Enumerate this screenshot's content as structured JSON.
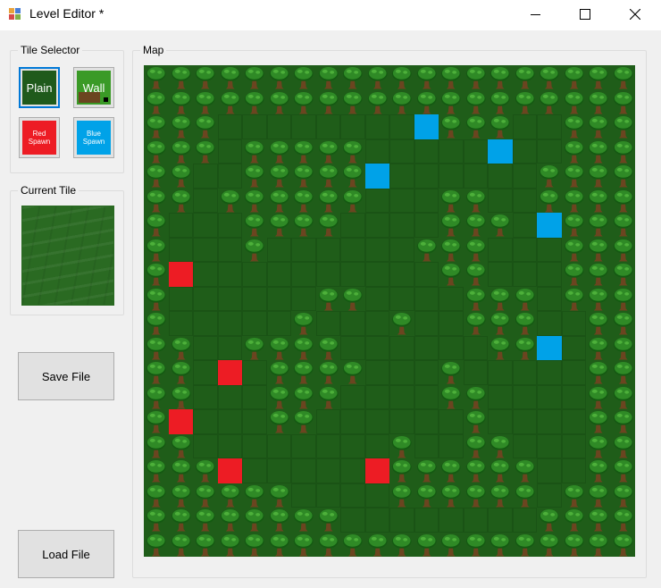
{
  "window": {
    "title": "Level Editor *"
  },
  "tile_selector": {
    "label": "Tile Selector",
    "tiles": [
      {
        "label": "Plain",
        "selected": true
      },
      {
        "label": "Wall",
        "selected": false
      },
      {
        "label": "Red Spawn",
        "selected": false
      },
      {
        "label": "Blue Spawn",
        "selected": false
      }
    ]
  },
  "current_tile": {
    "label": "Current Tile",
    "tile": "plain"
  },
  "buttons": {
    "save": "Save File",
    "load": "Load File"
  },
  "map": {
    "label": "Map",
    "columns": 20,
    "rows": 20,
    "legend": {
      "P": "plain",
      "W": "wall (tree)",
      "R": "red spawn",
      "B": "blue spawn"
    },
    "grid": [
      "WWWWWWWWWWWWWWWWWWWW",
      "WWWWWWWWWWWWWWWWWWWW",
      "WWWPPPPPPPPBWWWPPWWW",
      "WWWPWWWWWPPPPPBPPWWW",
      "WWPPWWWWWBPPPPPPWWWW",
      "WWPWWWWWWPPPWWPPWWWW",
      "WPPPWWWWPPPPWWWPBWWW",
      "WPPPWPPPPPPWWWPPPWWW",
      "WRPPPPPPPPPPWWPPPWWW",
      "WPPPPPPWWPPPPWWWPWWW",
      "WPPPPPWPPPWPPWWWPPWW",
      "WWPPWWWWPPPPPPWWBPWW",
      "WWPRPWWWWPPPWPPPPPWW",
      "WWPPPWWWPPPPWWPPPPWW",
      "WRPPPWWPPPPPPWPPPPWW",
      "WWPPPPPPPPWPPWWPPPWW",
      "WWWRPPPPPRWWWWWWPPWW",
      "WWWWWWPPPPWWWWWWPWWW",
      "WWWWWWWWPPPPPPPPWWWW",
      "WWWWWWWWWWWWWWWWWWWW"
    ]
  },
  "colors": {
    "plain": "#1f5d19",
    "red_spawn": "#ed1c24",
    "blue_spawn": "#00a2e8",
    "tree_canopy": "#2f8a26",
    "tree_trunk": "#6b4520"
  },
  "icons": {
    "app": "level-editor-icon",
    "minimize": "minimize-icon",
    "maximize": "maximize-icon",
    "close": "close-icon"
  }
}
